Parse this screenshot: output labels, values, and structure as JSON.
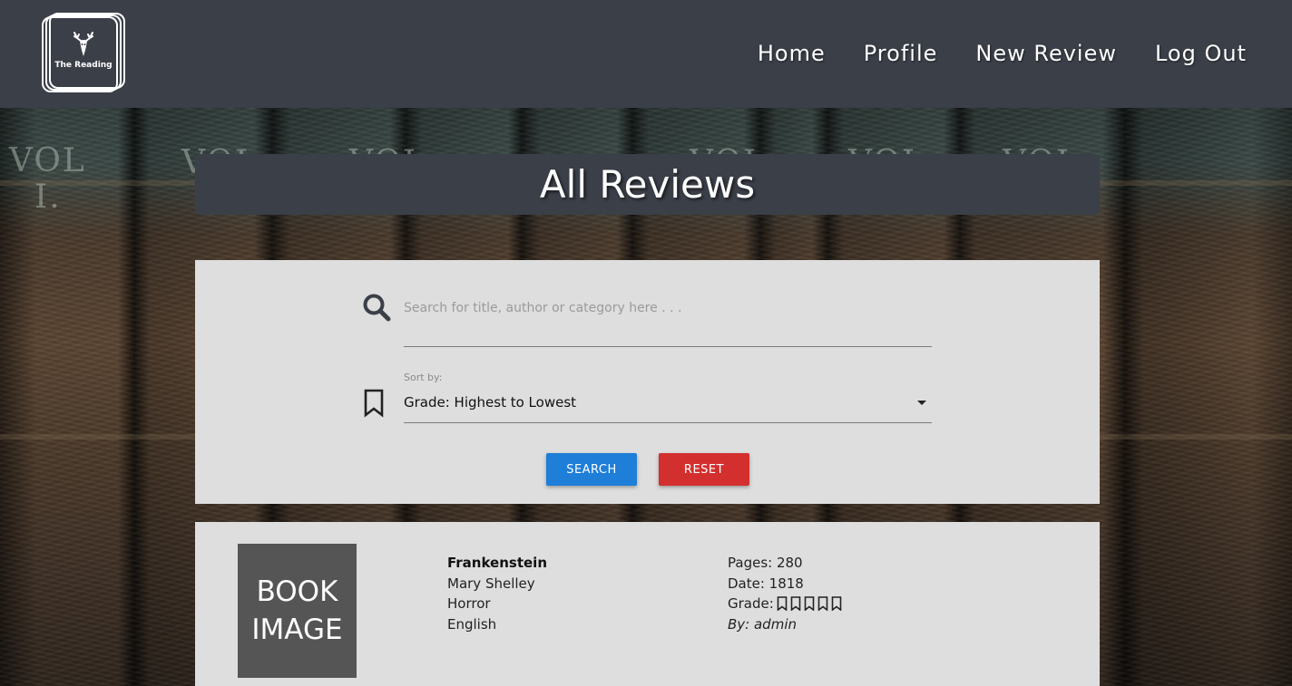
{
  "header": {
    "logo_text": "The Reading",
    "nav": [
      "Home",
      "Profile",
      "New Review",
      "Log Out"
    ]
  },
  "page_title": "All Reviews",
  "search": {
    "placeholder": "Search for title, author or category here . . .",
    "sort_label": "Sort by:",
    "sort_value": "Grade: Highest to Lowest",
    "search_button": "SEARCH",
    "reset_button": "RESET"
  },
  "review": {
    "image_line1": "BOOK",
    "image_line2": "IMAGE",
    "title": "Frankenstein",
    "author": "Mary Shelley",
    "category": "Horror",
    "language": "English",
    "pages": "Pages: 280",
    "date": "Date: 1818",
    "grade_label": "Grade:",
    "grade_icons": 5,
    "by": "By: admin"
  },
  "colors": {
    "header_bg": "#3b3f48",
    "card_bg": "#dedede",
    "search_button": "#1e7ed8",
    "reset_button": "#d32f2f"
  },
  "icons": [
    "deer-logo-icon",
    "search-icon",
    "bookmark-icon",
    "dropdown-caret-icon",
    "bookmark-outline-icon"
  ]
}
